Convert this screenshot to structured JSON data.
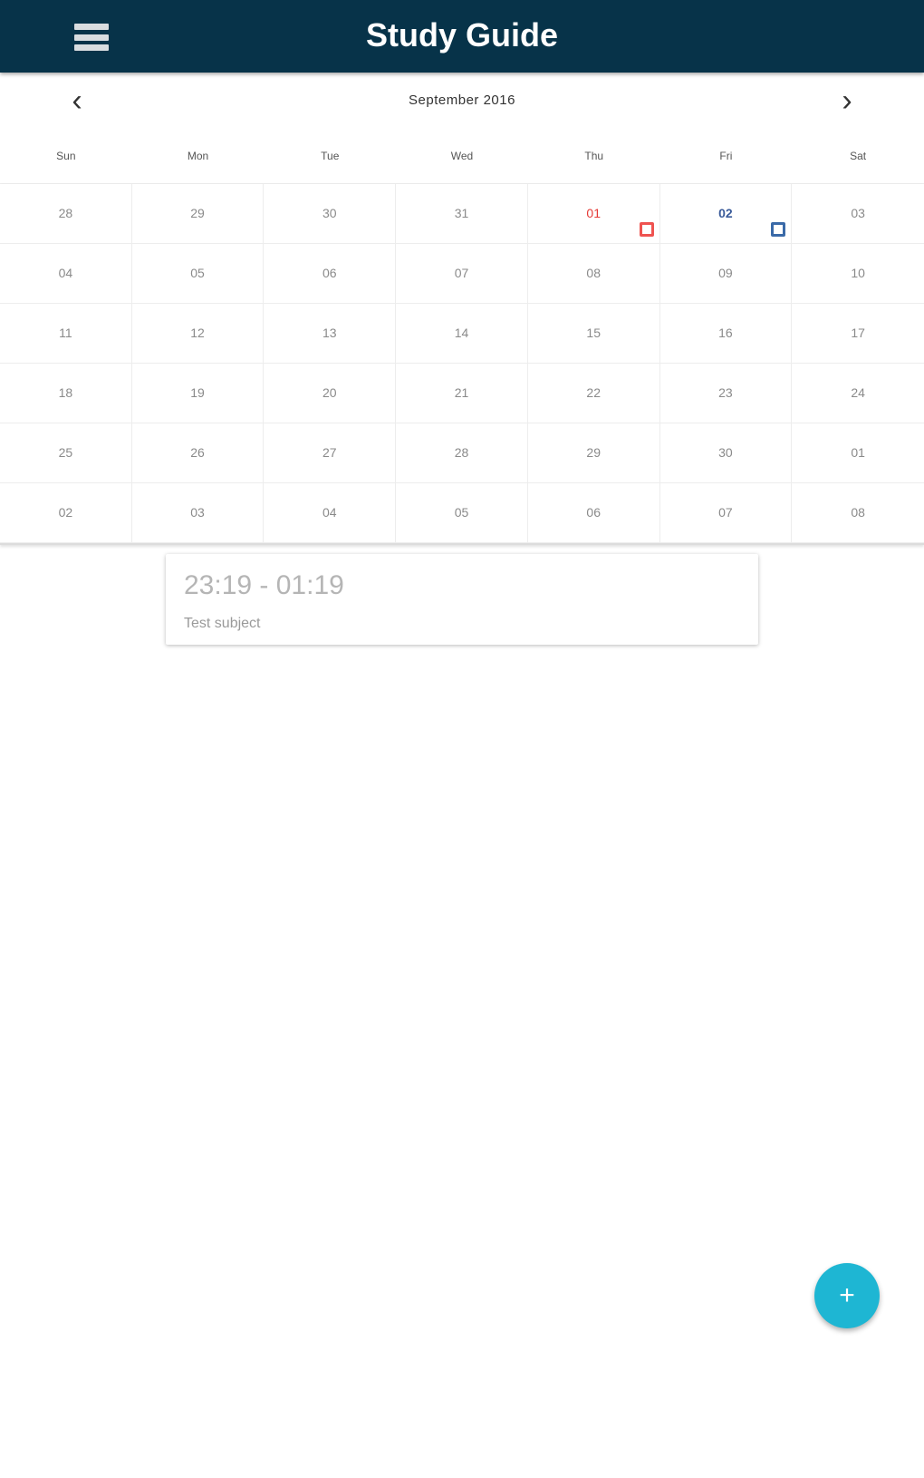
{
  "app_bar": {
    "title": "Study Guide",
    "menu_icon": "hamburger-menu-icon",
    "background_color": "#073349"
  },
  "calendar": {
    "month_label": "September 2016",
    "prev_icon": "chevron-left-icon",
    "next_icon": "chevron-right-icon",
    "prev_glyph": "‹",
    "next_glyph": "›",
    "weekdays": [
      "Sun",
      "Mon",
      "Tue",
      "Wed",
      "Thu",
      "Fri",
      "Sat"
    ],
    "weeks": [
      [
        "28",
        "29",
        "30",
        "31",
        "01",
        "02",
        "03"
      ],
      [
        "04",
        "05",
        "06",
        "07",
        "08",
        "09",
        "10"
      ],
      [
        "11",
        "12",
        "13",
        "14",
        "15",
        "16",
        "17"
      ],
      [
        "18",
        "19",
        "20",
        "21",
        "22",
        "23",
        "24"
      ],
      [
        "25",
        "26",
        "27",
        "28",
        "29",
        "30",
        "01"
      ],
      [
        "02",
        "03",
        "04",
        "05",
        "06",
        "07",
        "08"
      ]
    ],
    "highlights": {
      "today_color": "#e53935",
      "selected_color": "#3a5b9a"
    }
  },
  "event": {
    "time": "23:19 - 01:19",
    "subject": "Test subject"
  },
  "fab": {
    "icon": "plus-icon",
    "glyph": "+",
    "color": "#1eb6d3"
  }
}
